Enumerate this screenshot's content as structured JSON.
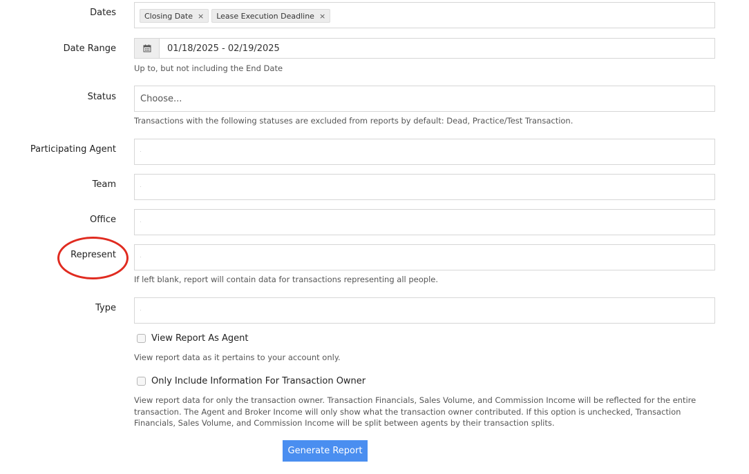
{
  "dates": {
    "label": "Dates",
    "tags": [
      "Closing Date",
      "Lease Execution Deadline"
    ],
    "remove_glyph": "×"
  },
  "date_range": {
    "label": "Date Range",
    "value": "01/18/2025 - 02/19/2025",
    "help": "Up to, but not including the End Date",
    "icon": "calendar-icon"
  },
  "status": {
    "label": "Status",
    "placeholder": "Choose...",
    "help": "Transactions with the following statuses are excluded from reports by default: Dead, Practice/Test Transaction."
  },
  "participating_agent": {
    "label": "Participating Agent"
  },
  "team": {
    "label": "Team"
  },
  "office": {
    "label": "Office"
  },
  "represent": {
    "label": "Represent",
    "help": "If left blank, report will contain data for transactions representing all people.",
    "highlight_color": "#e02b20"
  },
  "type": {
    "label": "Type"
  },
  "view_as_agent": {
    "label": "View Report As Agent",
    "checked": false,
    "help": "View report data as it pertains to your account only."
  },
  "owner_only": {
    "label": "Only Include Information For Transaction Owner",
    "checked": false,
    "help": "View report data for only the transaction owner. Transaction Financials, Sales Volume, and Commission Income will be reflected for the entire transaction. The Agent and Broker Income will only show what the transaction owner contributed. If this option is unchecked, Transaction Financials, Sales Volume, and Commission Income will be split between agents by their transaction splits."
  },
  "generate_button": {
    "label": "Generate Report",
    "color": "#4a8ef0"
  }
}
